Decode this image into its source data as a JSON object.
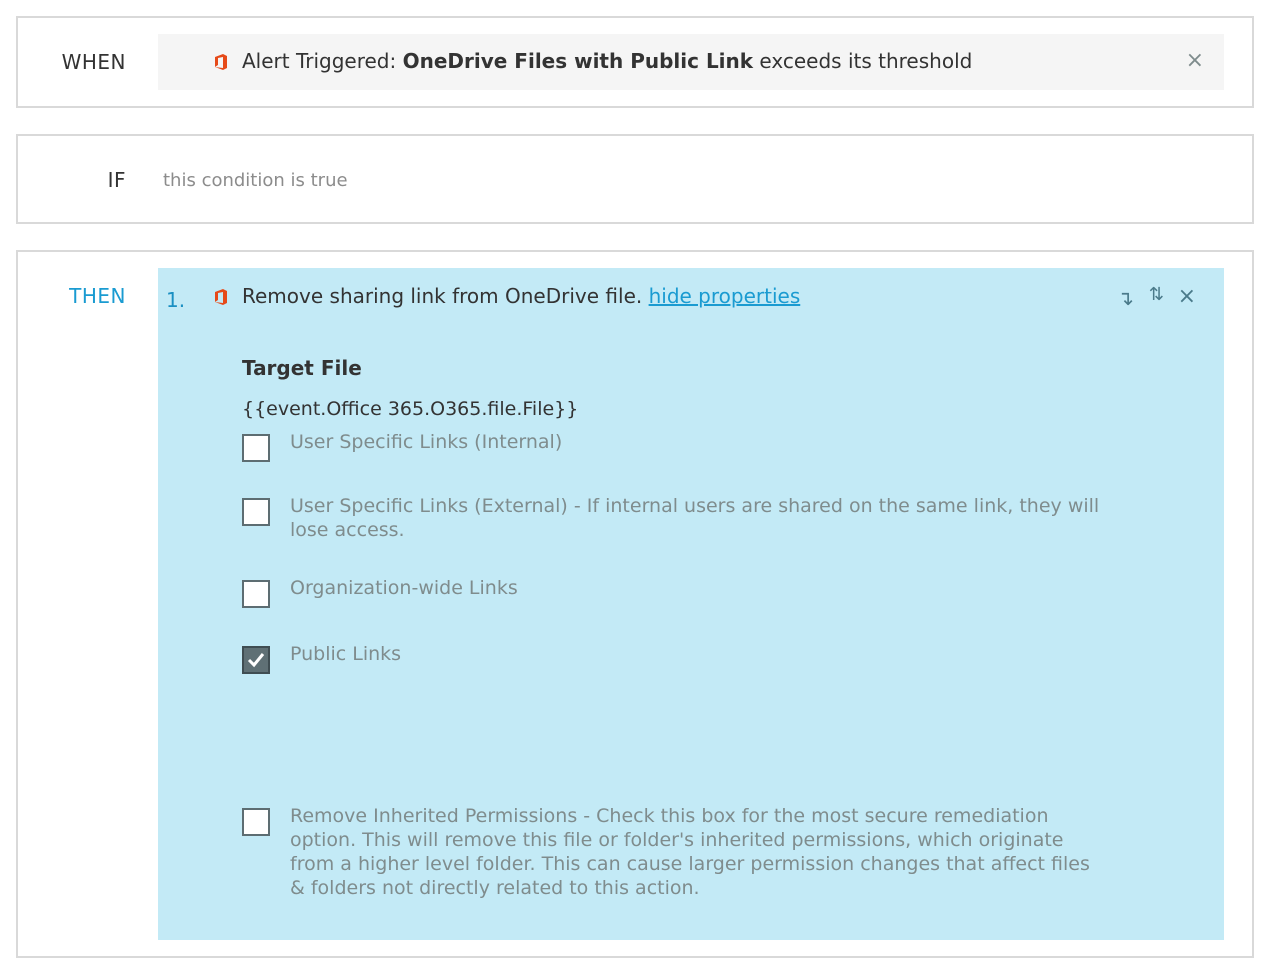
{
  "when": {
    "label": "WHEN",
    "trigger_prefix": "Alert Triggered: ",
    "trigger_name": "OneDrive Files with Public Link",
    "trigger_suffix": " exceeds its threshold",
    "close_symbol": "×",
    "icon": "office365-icon"
  },
  "if": {
    "label": "IF",
    "placeholder": "this condition is true"
  },
  "then": {
    "label": "THEN",
    "actions": [
      {
        "number": "1.",
        "icon": "office365-icon",
        "title": "Remove sharing link from OneDrive file. ",
        "toggle_link": "hide properties",
        "tools": {
          "move_down": "↴",
          "swap": "⇅",
          "remove": "×"
        },
        "properties": {
          "heading": "Target File",
          "value": "{{event.Office 365.O365.file.File}}",
          "options": [
            {
              "label": "User Specific Links (Internal)",
              "checked": false
            },
            {
              "label": "User Specific Links (External) - If internal users are shared on the same link, they will lose access.",
              "checked": false
            },
            {
              "label": "Organization-wide Links",
              "checked": false
            },
            {
              "label": "Public Links",
              "checked": true
            },
            {
              "label": "Remove Inherited Permissions - Check this box for the most secure remediation option. This will remove this file or folder's inherited permissions, which originate from a higher level folder. This can cause larger permission changes that affect files & folders not directly related to this action.",
              "checked": false
            }
          ]
        }
      }
    ]
  },
  "colors": {
    "accent": "#1a9bd1",
    "action_bg": "#c3eaf6",
    "office_red": "#e64a19"
  }
}
